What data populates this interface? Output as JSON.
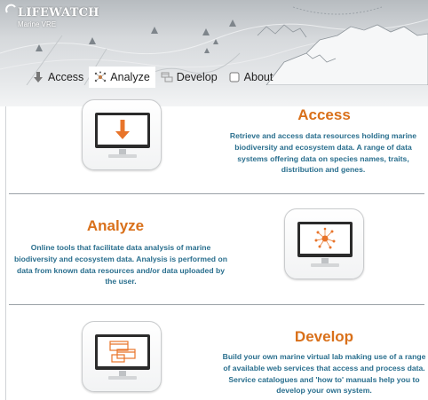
{
  "header": {
    "logo_title": "LIFEWATCH",
    "logo_subtitle": "Marine VRE"
  },
  "nav": {
    "tabs": [
      {
        "label": "Access",
        "icon": "download-arrow-icon"
      },
      {
        "label": "Analyze",
        "icon": "network-nodes-icon"
      },
      {
        "label": "Develop",
        "icon": "develop-windows-icon"
      },
      {
        "label": "About",
        "icon": "checkbox-icon"
      }
    ],
    "active_tab": "Analyze"
  },
  "sections": {
    "access": {
      "title": "Access",
      "text": "Retrieve and access data resources holding marine biodiversity and ecosystem data. A range of data systems offering data on species names, traits, distribution and genes.",
      "icon": "download-monitor-icon"
    },
    "analyze": {
      "title": "Analyze",
      "text": "Online tools that facilitate data analysis of marine biodiversity and ecosystem data. Analysis is performed on data from known data resources and/or data uploaded by the user.",
      "icon": "network-monitor-icon"
    },
    "develop": {
      "title": "Develop",
      "text": "Build your own marine virtual lab making use of a range of available web services that access and process data. Service catalogues and 'how to' manuals help you to develop your own system.",
      "icon": "windows-monitor-icon"
    }
  },
  "colors": {
    "title_orange": "#d9701a",
    "text_blue": "#2a6f8e",
    "divider": "#9aa1a7"
  }
}
